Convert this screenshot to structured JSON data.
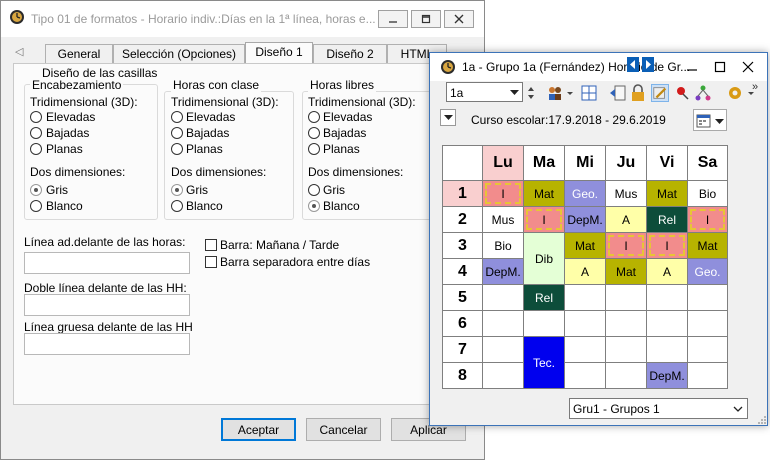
{
  "dialog": {
    "title": "Tipo 01 de formatos - Horario indiv.:Días en la 1ª línea, horas e...",
    "tabs": [
      "General",
      "Selección (Opciones)",
      "Diseño 1",
      "Diseño 2",
      "HTML"
    ],
    "section_title": "Diseño de las casillas",
    "columns": [
      {
        "heading": "Encabezamiento",
        "threed_label": "Tridimensional (3D):",
        "threed_options": [
          "Elevadas",
          "Bajadas",
          "Planas"
        ],
        "twod_label": "Dos dimensiones:",
        "twod_options": [
          "Gris",
          "Blanco"
        ],
        "twod_selected": "Gris"
      },
      {
        "heading": "Horas con clase",
        "threed_label": "Tridimensional (3D):",
        "threed_options": [
          "Elevadas",
          "Bajadas",
          "Planas"
        ],
        "twod_label": "Dos dimensiones:",
        "twod_options": [
          "Gris",
          "Blanco"
        ],
        "twod_selected": "Gris"
      },
      {
        "heading": "Horas libres",
        "threed_label": "Tridimensional (3D):",
        "threed_options": [
          "Elevadas",
          "Bajadas",
          "Planas"
        ],
        "twod_label": "Dos dimensiones:",
        "twod_options": [
          "Gris",
          "Blanco"
        ],
        "twod_selected": "Blanco"
      }
    ],
    "line_fields": [
      {
        "label": "Línea ad.delante de las horas:",
        "value": ""
      },
      {
        "label": "Doble línea delante de las HH:",
        "value": ""
      },
      {
        "label": "Línea gruesa delante de las HH",
        "value": ""
      }
    ],
    "checks": [
      {
        "label": "Barra:  Mañana / Tarde",
        "checked": false
      },
      {
        "label": "Barra separadora entre días",
        "checked": false
      }
    ],
    "buttons": {
      "accept": "Aceptar",
      "cancel": "Cancelar",
      "apply": "Aplicar"
    }
  },
  "timetable_window": {
    "title": "1a - Grupo 1a (Fernández)  Horario de Gr...",
    "class_select": "1a",
    "school_year": "Curso escolar:17.9.2018 - 29.6.2019",
    "group_select": "Gru1 - Grupos 1",
    "days": [
      "Lu",
      "Ma",
      "Mi",
      "Ju",
      "Vi",
      "Sa"
    ],
    "periods": [
      "1",
      "2",
      "3",
      "4",
      "5",
      "6",
      "7",
      "8"
    ],
    "colors": {
      "pink": "#f28c8c",
      "olive": "#b7b300",
      "lilac": "#8f8fdc",
      "white": "#ffffff",
      "lightgreen": "#e4ffd6",
      "darkgreen": "#0d4d3a",
      "lightyellow": "#ffffa8",
      "blue": "#0000ee",
      "dash": "#e7c536",
      "header_today": "#f9cfcf"
    },
    "lessons": [
      [
        "I",
        "Mat",
        "Geo.",
        "Mus",
        "Mat",
        "Bio"
      ],
      [
        "Mus",
        "I",
        "DepM.",
        "A",
        "Rel",
        "I"
      ],
      [
        "Bio",
        "Dib",
        "Mat",
        "I",
        "I",
        "Mat"
      ],
      [
        "DepM.",
        "",
        "A",
        "Mat",
        "A",
        "Geo."
      ],
      [
        "",
        "Rel",
        "",
        "",
        "",
        ""
      ],
      [
        "",
        "",
        "",
        "",
        "",
        ""
      ],
      [
        "",
        "Tec.",
        "",
        "",
        "",
        ""
      ],
      [
        "",
        "",
        "",
        "",
        "DepM.",
        ""
      ]
    ]
  }
}
